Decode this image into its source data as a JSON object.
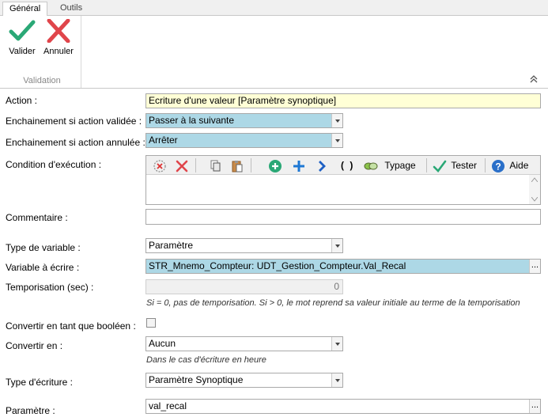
{
  "ribbon": {
    "tabs": [
      "Général",
      "Outils"
    ],
    "validate_label": "Valider",
    "cancel_label": "Annuler",
    "group_label": "Validation"
  },
  "form": {
    "action": {
      "label": "Action :",
      "value": "Ecriture d'une valeur [Paramètre synoptique]"
    },
    "chain_validated": {
      "label": "Enchainement si action validée :",
      "value": "Passer à la suivante"
    },
    "chain_cancelled": {
      "label": "Enchainement si action annulée :",
      "value": "Arrêter"
    },
    "condition": {
      "label": "Condition d'exécution :",
      "typage_label": "Typage",
      "parens_label": "( )",
      "tester_label": "Tester",
      "aide_label": "Aide"
    },
    "comment": {
      "label": "Commentaire :",
      "value": ""
    },
    "var_type": {
      "label": "Type de variable :",
      "value": "Paramètre"
    },
    "var_write": {
      "label": "Variable à écrire :",
      "value": "STR_Mnemo_Compteur: UDT_Gestion_Compteur.Val_Recal"
    },
    "delay": {
      "label": "Temporisation (sec) :",
      "value": "0",
      "note": "Si = 0, pas de temporisation. Si > 0, le mot reprend sa valeur initiale au terme de la temporisation"
    },
    "as_bool": {
      "label": "Convertir en tant que booléen :"
    },
    "convert_to": {
      "label": "Convertir en :",
      "value": "Aucun",
      "note": "Dans le cas d'écriture en heure"
    },
    "write_type": {
      "label": "Type d'écriture :",
      "value": "Paramètre Synoptique"
    },
    "param": {
      "label": "Paramètre :",
      "value": "val_recal"
    }
  },
  "colors": {
    "yellow_field": "#ffffd6",
    "blue_field": "#add8e6",
    "check_green": "#2aa876",
    "cross_red": "#e0454b"
  },
  "icons": [
    "check-icon",
    "cross-icon",
    "clear-icon",
    "delete-icon",
    "copy-icon",
    "paste-icon",
    "add-icon",
    "plus-icon",
    "chevron-right-icon",
    "typage-icon",
    "tester-check-icon",
    "help-icon",
    "collapse-ribbon-icon"
  ]
}
